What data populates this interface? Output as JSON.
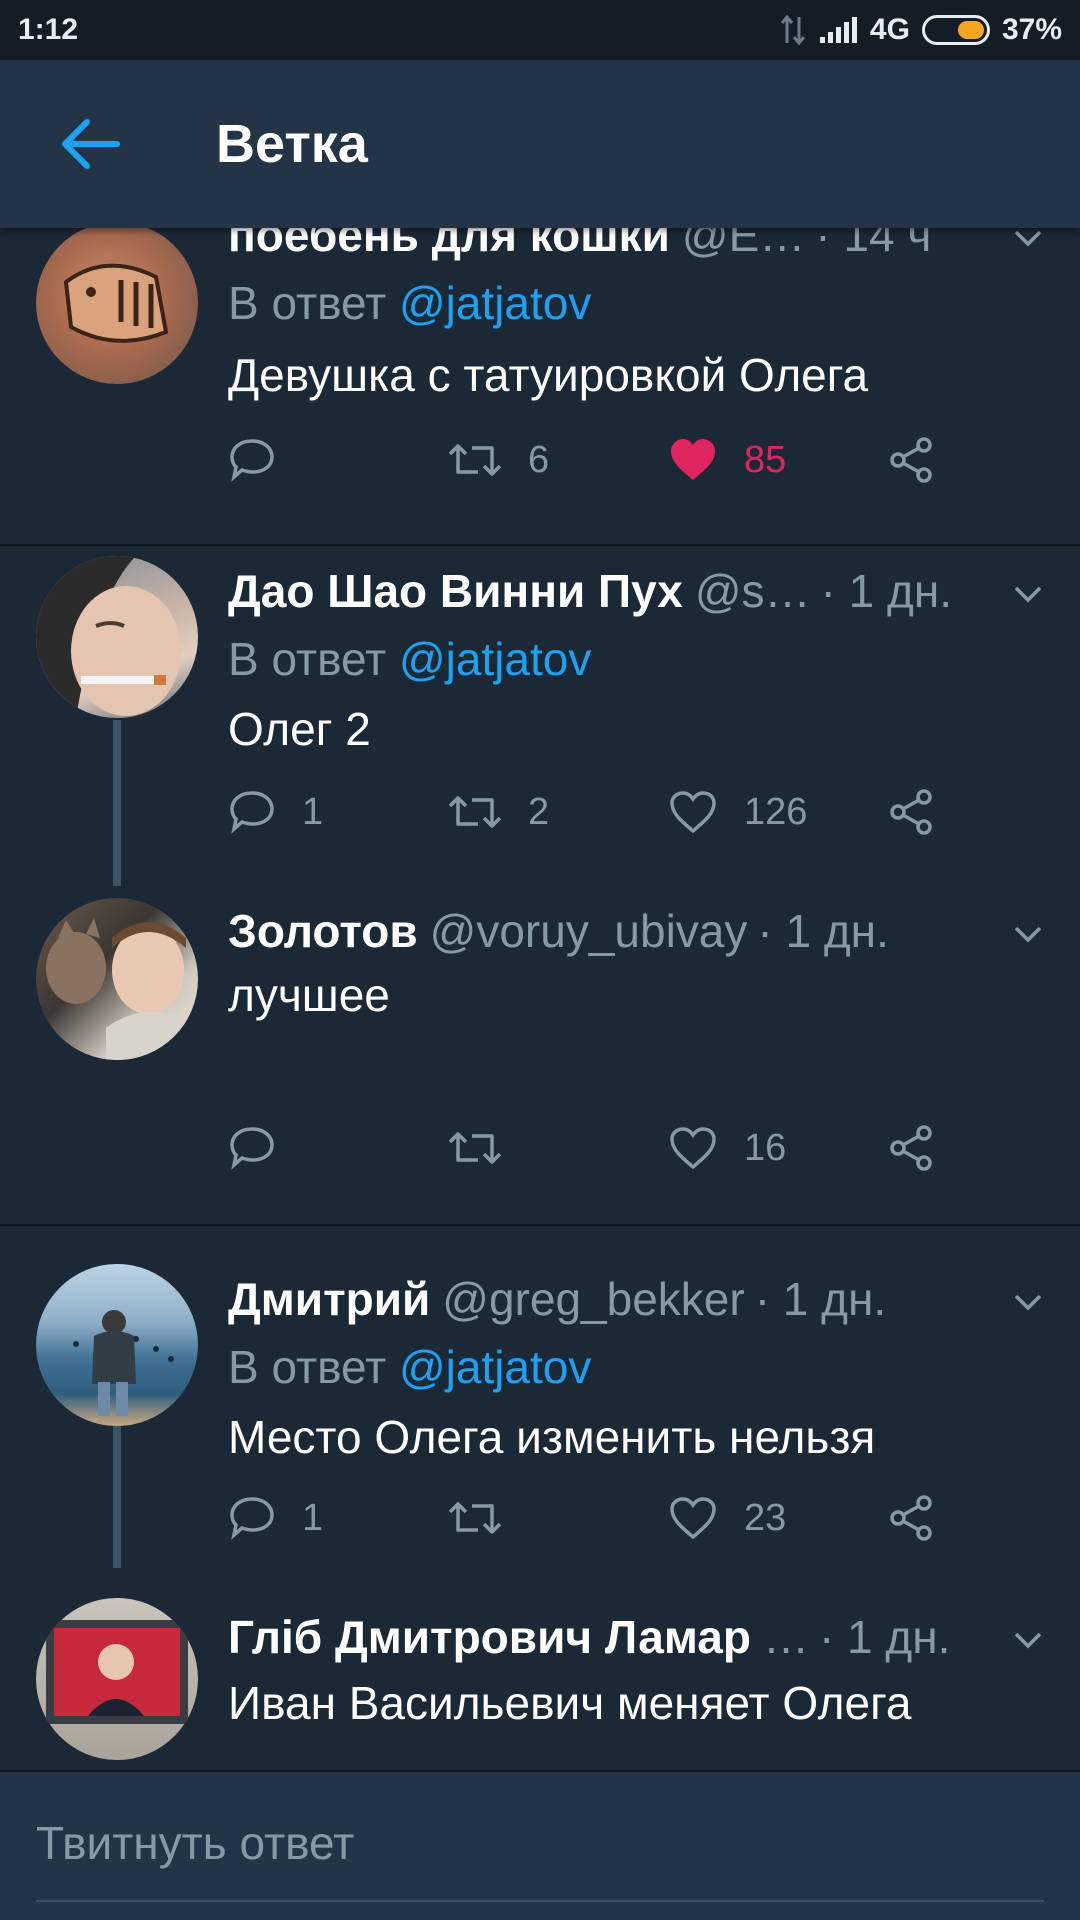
{
  "status_bar": {
    "time": "1:12",
    "network": "4G",
    "battery": "37%",
    "battery_level": 0.37
  },
  "header": {
    "title": "Ветка"
  },
  "tweets": [
    {
      "name": "поебень для кошки",
      "handle": "@E…",
      "time": "· 14 ч",
      "reply_prefix": "В ответ",
      "reply_to": "@jatjatov",
      "text": "Девушка с татуировкой Олега",
      "replies": "",
      "retweets": "6",
      "likes": "85",
      "liked": true
    },
    {
      "name": "Дао Шао Винни Пух",
      "handle": "@s…",
      "time": "· 1 дн.",
      "reply_prefix": "В ответ",
      "reply_to": "@jatjatov",
      "text": "Олег 2",
      "replies": "1",
      "retweets": "2",
      "likes": "126",
      "liked": false
    },
    {
      "name": "Золотов",
      "handle": "@voruy_ubivay",
      "time": "· 1 дн.",
      "text": "лучшее",
      "replies": "",
      "retweets": "",
      "likes": "16",
      "liked": false
    },
    {
      "name": "Дмитрий",
      "handle": "@greg_bekker",
      "time": "· 1 дн.",
      "reply_prefix": "В ответ",
      "reply_to": "@jatjatov",
      "text": "Место Олега изменить нельзя",
      "replies": "1",
      "retweets": "",
      "likes": "23",
      "liked": false
    },
    {
      "name": "Гліб Дмитрович Ламар",
      "handle": "…",
      "time": "· 1 дн.",
      "text": "Иван Васильевич меняет Олега"
    }
  ],
  "compose": {
    "placeholder": "Твитнуть ответ"
  },
  "colors": {
    "background": "#1b2836",
    "header": "#243447",
    "accent": "#1da1f2",
    "like": "#e0245e",
    "muted": "#8899a6",
    "battery": "#f5a623"
  }
}
